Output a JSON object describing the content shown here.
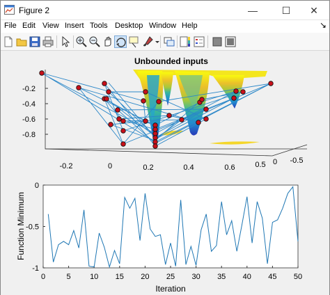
{
  "window": {
    "title": "Figure 2",
    "controls": {
      "minimize": "—",
      "maximize": "☐",
      "close": "✕"
    }
  },
  "menu": [
    "File",
    "Edit",
    "View",
    "Insert",
    "Tools",
    "Desktop",
    "Window",
    "Help"
  ],
  "toolbar": {
    "icons": [
      "new-figure-icon",
      "open-file-icon",
      "save-icon",
      "print-icon",
      "pointer-icon",
      "zoom-in-icon",
      "zoom-out-icon",
      "pan-icon",
      "rotate-3d-icon",
      "data-cursor-icon",
      "brush-icon",
      "brush-dropdown-icon",
      "link-plot-icon",
      "insert-colorbar-icon",
      "insert-legend-icon",
      "hide-plot-tools-icon",
      "show-plot-tools-icon"
    ],
    "active": "rotate-3d-icon",
    "menu_expand": "↘"
  },
  "chart_data": [
    {
      "type": "scatter",
      "title": "Unbounded inputs",
      "subtype": "3d-surface-with-path",
      "colormap": "parula",
      "x_ticks": [
        "-0.2",
        "0",
        "0.2",
        "0.4",
        "0.6"
      ],
      "y_ticks": [
        "0.5",
        "0",
        "-0.5"
      ],
      "z_ticks": [
        "-0.2",
        "-0.4",
        "-0.6",
        "-0.8"
      ],
      "z_range": [
        -0.95,
        0
      ],
      "points": [
        {
          "x": -0.32,
          "y": 0.55,
          "z": -0.02
        },
        {
          "x": -0.05,
          "y": 0.4,
          "z": -0.08
        },
        {
          "x": 0.05,
          "y": 0.25,
          "z": -0.1
        },
        {
          "x": 0.65,
          "y": -0.6,
          "z": -0.2
        },
        {
          "x": 0.22,
          "y": 0.05,
          "z": -0.9
        },
        {
          "x": 0.0,
          "y": 0.3,
          "z": -0.55
        },
        {
          "x": 0.1,
          "y": 0.2,
          "z": -0.3
        },
        {
          "x": 0.45,
          "y": -0.1,
          "z": -0.45
        }
      ],
      "marker_color": "#c8101a",
      "line_color": "#2b87c8"
    },
    {
      "type": "line",
      "xlabel": "Iteration",
      "ylabel": "Function Minimum",
      "xlim": [
        0,
        50
      ],
      "ylim": [
        -1,
        0
      ],
      "x_ticks": [
        0,
        5,
        10,
        15,
        20,
        25,
        30,
        35,
        40,
        45,
        50
      ],
      "y_ticks": [
        0,
        -0.5,
        -1
      ],
      "color": "#1f77b4",
      "x": [
        1,
        2,
        3,
        4,
        5,
        6,
        7,
        8,
        9,
        10,
        11,
        12,
        13,
        14,
        15,
        16,
        17,
        18,
        19,
        20,
        21,
        22,
        23,
        24,
        25,
        26,
        27,
        28,
        29,
        30,
        31,
        32,
        33,
        34,
        35,
        36,
        37,
        38,
        39,
        40,
        41,
        42,
        43,
        44,
        45,
        46,
        47,
        48,
        49,
        50
      ],
      "y": [
        -0.35,
        -0.93,
        -0.72,
        -0.68,
        -0.72,
        -0.55,
        -0.76,
        -0.3,
        -0.98,
        -0.99,
        -0.58,
        -0.75,
        -0.99,
        -0.79,
        -0.95,
        -0.15,
        -0.28,
        -0.16,
        -0.67,
        -0.1,
        -0.53,
        -0.62,
        -0.6,
        -0.96,
        -0.7,
        -0.98,
        -0.18,
        -0.96,
        -0.74,
        -0.97,
        -0.54,
        -0.35,
        -0.8,
        -0.73,
        -0.2,
        -0.6,
        -0.43,
        -0.8,
        -0.48,
        -0.14,
        -0.7,
        -0.2,
        -0.4,
        -0.95,
        -0.45,
        -0.42,
        -0.28,
        -0.1,
        -0.02,
        -0.68
      ]
    }
  ]
}
